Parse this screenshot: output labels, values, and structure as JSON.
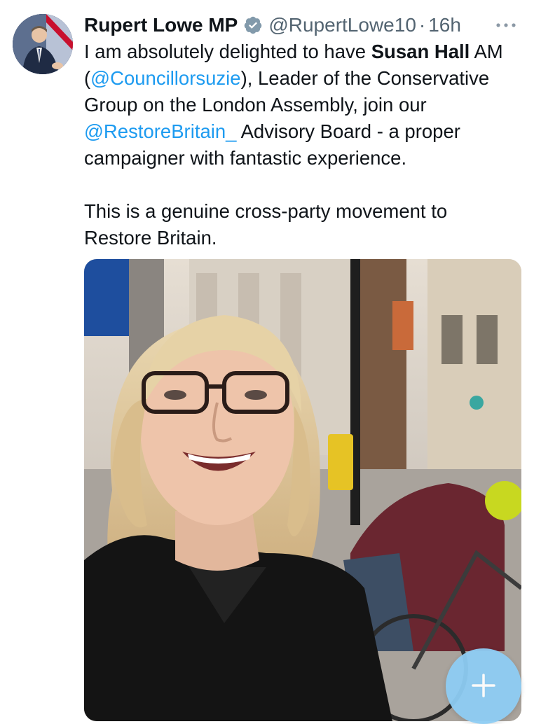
{
  "tweet": {
    "author": {
      "display_name": "Rupert Lowe MP",
      "handle": "@RupertLowe10",
      "verified": true,
      "avatar_icon": "profile-photo"
    },
    "separator": "·",
    "time": "16h",
    "more_icon": "more-horizontal-icon",
    "body": {
      "p1_t1": "I am absolutely delighted to have ",
      "p1_bold": "Susan Hall",
      "p1_t2": " AM (",
      "p1_mention1": "@Councillorsuzie",
      "p1_t3": "), Leader of the Conservative Group on the London Assembly, join our ",
      "p1_mention2": "@RestoreBritain_",
      "p1_t4": " Advisory Board - a proper campaigner with fantastic experience.",
      "p2": "This is a genuine cross-party movement to Restore Britain."
    },
    "media": {
      "type": "photo"
    }
  },
  "compose_button": {
    "icon": "plus-icon"
  },
  "colors": {
    "text": "#0f1419",
    "secondary": "#536471",
    "link": "#1d9bf0",
    "verified_badge": "#829aab",
    "fab": "#8ecdf4"
  }
}
